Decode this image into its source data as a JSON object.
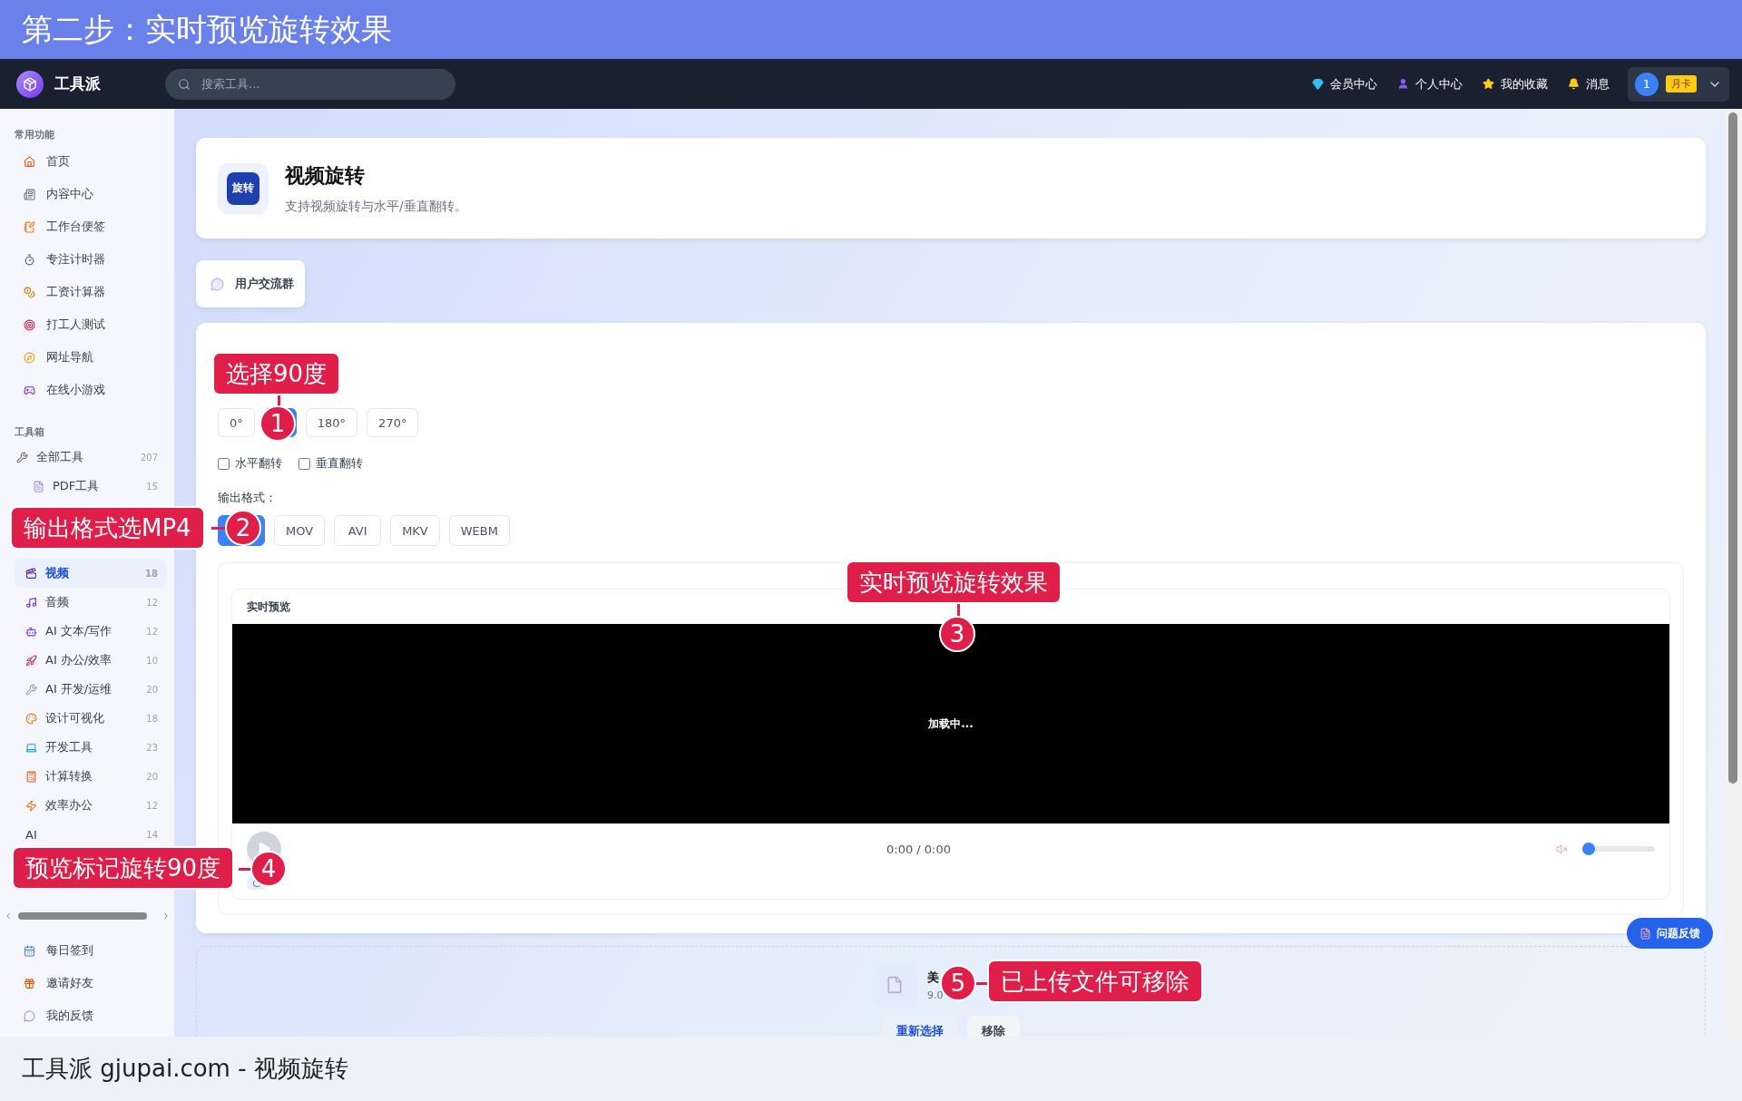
{
  "banner": {
    "title": "第二步：实时预览旋转效果"
  },
  "navbar": {
    "logo": "工具派",
    "search_placeholder": "搜索工具...",
    "links": [
      "会员中心",
      "个人中心",
      "我的收藏",
      "消息"
    ],
    "user": {
      "avatar": "1",
      "badge": "月卡"
    }
  },
  "sidebar": {
    "common_title": "常用功能",
    "common_items": [
      {
        "label": "首页"
      },
      {
        "label": "内容中心"
      },
      {
        "label": "工作台便签"
      },
      {
        "label": "专注计时器"
      },
      {
        "label": "工资计算器"
      },
      {
        "label": "打工人测试"
      },
      {
        "label": "网址导航"
      },
      {
        "label": "在线小游戏"
      }
    ],
    "tools_title": "工具箱",
    "all_tools": {
      "label": "全部工具",
      "count": "207"
    },
    "categories": [
      {
        "label": "PDF工具",
        "count": "15",
        "selected": false
      },
      {
        "label": "视频",
        "count": "18",
        "selected": true
      },
      {
        "label": "音频",
        "count": "12",
        "selected": false
      },
      {
        "label": "AI 文本/写作",
        "count": "12",
        "selected": false
      },
      {
        "label": "AI 办公/效率",
        "count": "10",
        "selected": false
      },
      {
        "label": "AI 开发/运维",
        "count": "20",
        "selected": false
      },
      {
        "label": "设计可视化",
        "count": "18",
        "selected": false
      },
      {
        "label": "开发工具",
        "count": "23",
        "selected": false
      },
      {
        "label": "计算转换",
        "count": "20",
        "selected": false
      },
      {
        "label": "效率办公",
        "count": "12",
        "selected": false
      },
      {
        "label": "AI",
        "count": "14",
        "selected": false
      }
    ],
    "footer_items": [
      {
        "label": "每日签到"
      },
      {
        "label": "邀请好友"
      },
      {
        "label": "我的反馈"
      }
    ]
  },
  "tool": {
    "icon_text": "旋转",
    "title": "视频旋转",
    "description": "支持视频旋转与水平/垂直翻转。"
  },
  "community_button": "用户交流群",
  "settings": {
    "angles": [
      {
        "label": "0°",
        "selected": false
      },
      {
        "selected": true
      },
      {
        "label": "180°",
        "selected": false
      },
      {
        "label": "270°",
        "selected": false
      }
    ],
    "flips": [
      {
        "label": "水平翻转",
        "checked": false
      },
      {
        "label": "垂直翻转",
        "checked": false
      }
    ],
    "format_label": "输出格式：",
    "formats": [
      {
        "selected": true
      },
      {
        "label": "MOV",
        "selected": false
      },
      {
        "label": "AVI",
        "selected": false
      },
      {
        "label": "MKV",
        "selected": false
      },
      {
        "label": "WEBM",
        "selected": false
      }
    ]
  },
  "preview": {
    "title": "实时预览",
    "status": "加载中...",
    "time": "0:00 / 0:00",
    "muted": true,
    "volume": {
      "level": 0
    }
  },
  "file": {
    "name": "美",
    "size": "9.0"
  },
  "file_actions": [
    {
      "label": "重新选择",
      "kind": "primary"
    },
    {
      "label": "移除",
      "kind": "secondary"
    }
  ],
  "feedback_button": "问题反馈",
  "annotations": [
    {
      "number": "1",
      "text": "选择90度"
    },
    {
      "number": "2",
      "text": "输出格式选MP4"
    },
    {
      "number": "3",
      "text": "实时预览旋转效果"
    },
    {
      "number": "4",
      "text": "预览标记旋转90度"
    },
    {
      "number": "5",
      "text": "已上传文件可移除"
    }
  ],
  "caption": "工具派 gjupai.com - 视频旋转"
}
